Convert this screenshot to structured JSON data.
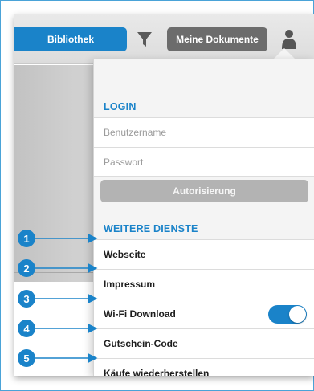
{
  "toolbar": {
    "library_label": "Bibliothek",
    "my_documents_label": "Meine Dokumente"
  },
  "popover": {
    "login": {
      "header": "LOGIN",
      "username_placeholder": "Benutzername",
      "password_placeholder": "Passwort",
      "authorize_label": "Autorisierung"
    },
    "services": {
      "header": "WEITERE DIENSTE",
      "items": [
        {
          "label": "Webseite"
        },
        {
          "label": "Impressum"
        },
        {
          "label": "Wi-Fi Download",
          "toggle_on": true
        },
        {
          "label": "Gutschein-Code"
        },
        {
          "label": "Käufe wiederherstellen"
        }
      ]
    }
  },
  "callouts": [
    "1",
    "2",
    "3",
    "4",
    "5"
  ],
  "colors": {
    "accent": "#1a83c9",
    "toolbar_gray_button": "#6c6c6c",
    "disabled_button": "#b3b3b3"
  },
  "icons": {
    "filter": "filter-icon",
    "user": "user-icon"
  }
}
